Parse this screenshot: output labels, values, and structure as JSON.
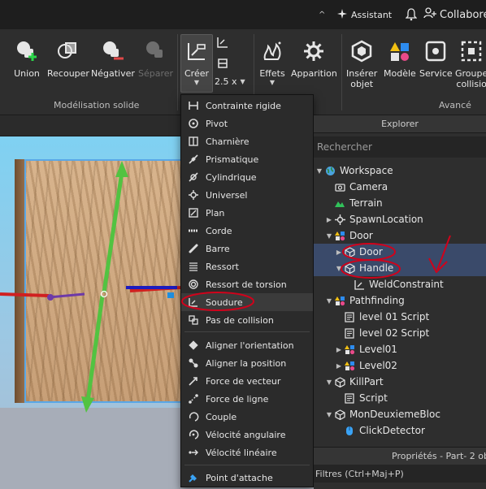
{
  "topbar": {
    "caret": "^",
    "assistant_label": "Assistant",
    "collaborate_label": "Collabore"
  },
  "ribbon": {
    "union": "Union",
    "recouper": "Recouper",
    "negatif": "Négativer",
    "separer": "Séparer",
    "creer": "Créer",
    "scale_value": "2.5 x",
    "effets": "Effets",
    "apparition": "Apparition",
    "inserer_line1": "Insérer",
    "inserer_line2": "objet",
    "modele": "Modèle",
    "service": "Service",
    "groupe_line1": "Groupe",
    "groupe_line2": "collisio",
    "group_modelisation": "Modélisation solide",
    "group_avance": "Avancé"
  },
  "menu": {
    "items": [
      {
        "label": "Contrainte rigide",
        "icon": "rigid-constraint-icon"
      },
      {
        "label": "Pivot",
        "icon": "pivot-icon"
      },
      {
        "label": "Charnière",
        "icon": "hinge-icon"
      },
      {
        "label": "Prismatique",
        "icon": "prismatic-icon"
      },
      {
        "label": "Cylindrique",
        "icon": "cylindrical-icon"
      },
      {
        "label": "Universel",
        "icon": "universal-icon"
      },
      {
        "label": "Plan",
        "icon": "plane-icon"
      },
      {
        "label": "Corde",
        "icon": "rope-icon"
      },
      {
        "label": "Barre",
        "icon": "rod-icon"
      },
      {
        "label": "Ressort",
        "icon": "spring-icon"
      },
      {
        "label": "Ressort de torsion",
        "icon": "torsion-spring-icon"
      },
      {
        "label": "Soudure",
        "icon": "weld-icon"
      },
      {
        "label": "Pas de collision",
        "icon": "no-collision-icon"
      },
      {
        "label": "Aligner l'orientation",
        "icon": "align-orientation-icon"
      },
      {
        "label": "Aligner la position",
        "icon": "align-position-icon"
      },
      {
        "label": "Force de vecteur",
        "icon": "vector-force-icon"
      },
      {
        "label": "Force de ligne",
        "icon": "line-force-icon"
      },
      {
        "label": "Couple",
        "icon": "torque-icon"
      },
      {
        "label": "Vélocité angulaire",
        "icon": "angular-velocity-icon"
      },
      {
        "label": "Vélocité linéaire",
        "icon": "linear-velocity-icon"
      },
      {
        "label": "Point d'attache",
        "icon": "attachment-icon"
      }
    ]
  },
  "explorer": {
    "title": "Explorer",
    "search_placeholder": "Rechercher",
    "tree": [
      {
        "label": "Workspace",
        "icon": "globe-icon"
      },
      {
        "label": "Camera",
        "icon": "camera-icon"
      },
      {
        "label": "Terrain",
        "icon": "terrain-icon"
      },
      {
        "label": "SpawnLocation",
        "icon": "spawn-icon"
      },
      {
        "label": "Door",
        "icon": "model-icon"
      },
      {
        "label": "Door",
        "icon": "part-icon"
      },
      {
        "label": "Handle",
        "icon": "part-icon"
      },
      {
        "label": "WeldConstraint",
        "icon": "weld-icon"
      },
      {
        "label": "Pathfinding",
        "icon": "model-icon"
      },
      {
        "label": "level 01 Script",
        "icon": "script-icon"
      },
      {
        "label": "level 02 Script",
        "icon": "script-icon"
      },
      {
        "label": "Level01",
        "icon": "model-icon"
      },
      {
        "label": "Level02",
        "icon": "model-icon"
      },
      {
        "label": "KillPart",
        "icon": "part-icon"
      },
      {
        "label": "Script",
        "icon": "script-icon"
      },
      {
        "label": "MonDeuxiemeBloc",
        "icon": "part-icon"
      },
      {
        "label": "ClickDetector",
        "icon": "click-detector-icon"
      }
    ],
    "properties_header": "Propriétés - Part- 2 ob",
    "filter_label": "Filtres (Ctrl+Maj+P)"
  },
  "colors": {
    "annotation_red": "#d0021b",
    "selection_blue": "#3a4a6a",
    "accent_green": "#2bd64a",
    "gizmo_green": "#52c341",
    "gizmo_blue": "#1c1cbf",
    "gizmo_red": "#d02020"
  }
}
